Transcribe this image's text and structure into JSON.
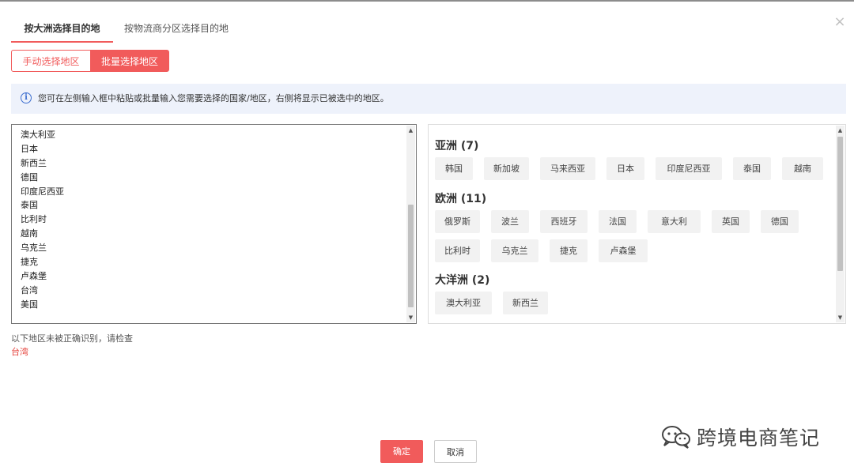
{
  "dialog": {
    "close_glyph": "×"
  },
  "tabs": [
    {
      "label": "按大洲选择目的地",
      "active": true
    },
    {
      "label": "按物流商分区选择目的地",
      "active": false
    }
  ],
  "mode_toggle": {
    "manual_label": "手动选择地区",
    "batch_label": "批量选择地区",
    "active": "batch"
  },
  "info": {
    "icon": "info-circle-icon",
    "glyph": "i",
    "text": "您可在左侧输入框中粘贴或批量输入您需要选择的国家/地区，右侧将显示已被选中的地区。"
  },
  "input_list": {
    "items": [
      "澳大利亚",
      "日本",
      "新西兰",
      "德国",
      "印度尼西亚",
      "泰国",
      "比利时",
      "越南",
      "乌克兰",
      "捷克",
      "卢森堡",
      "台湾",
      "美国"
    ]
  },
  "selected": {
    "groups": [
      {
        "title": "亚洲 (7)",
        "items": [
          "韩国",
          "新加坡",
          "马来西亚",
          "日本",
          "印度尼西亚",
          "泰国",
          "越南"
        ]
      },
      {
        "title": "欧洲 (11)",
        "items": [
          "俄罗斯",
          "波兰",
          "西班牙",
          "法国",
          "意大利",
          "英国",
          "德国",
          "比利时",
          "乌克兰",
          "捷克",
          "卢森堡"
        ]
      },
      {
        "title": "大洋洲 (2)",
        "items": [
          "澳大利亚",
          "新西兰"
        ]
      }
    ]
  },
  "scroll_glyphs": {
    "up": "▲",
    "down": "▼"
  },
  "unrecognized": {
    "message": "以下地区未被正确识别，请检查",
    "items": [
      "台湾"
    ],
    "color": "#e5403a"
  },
  "footer": {
    "confirm_label": "确定",
    "cancel_label": "取消"
  },
  "watermark": {
    "text": "跨境电商笔记",
    "icon": "wechat-icon"
  },
  "colors": {
    "accent": "#f15b5b",
    "info_bg": "#eef2fb",
    "info_icon": "#3e6fcf"
  }
}
